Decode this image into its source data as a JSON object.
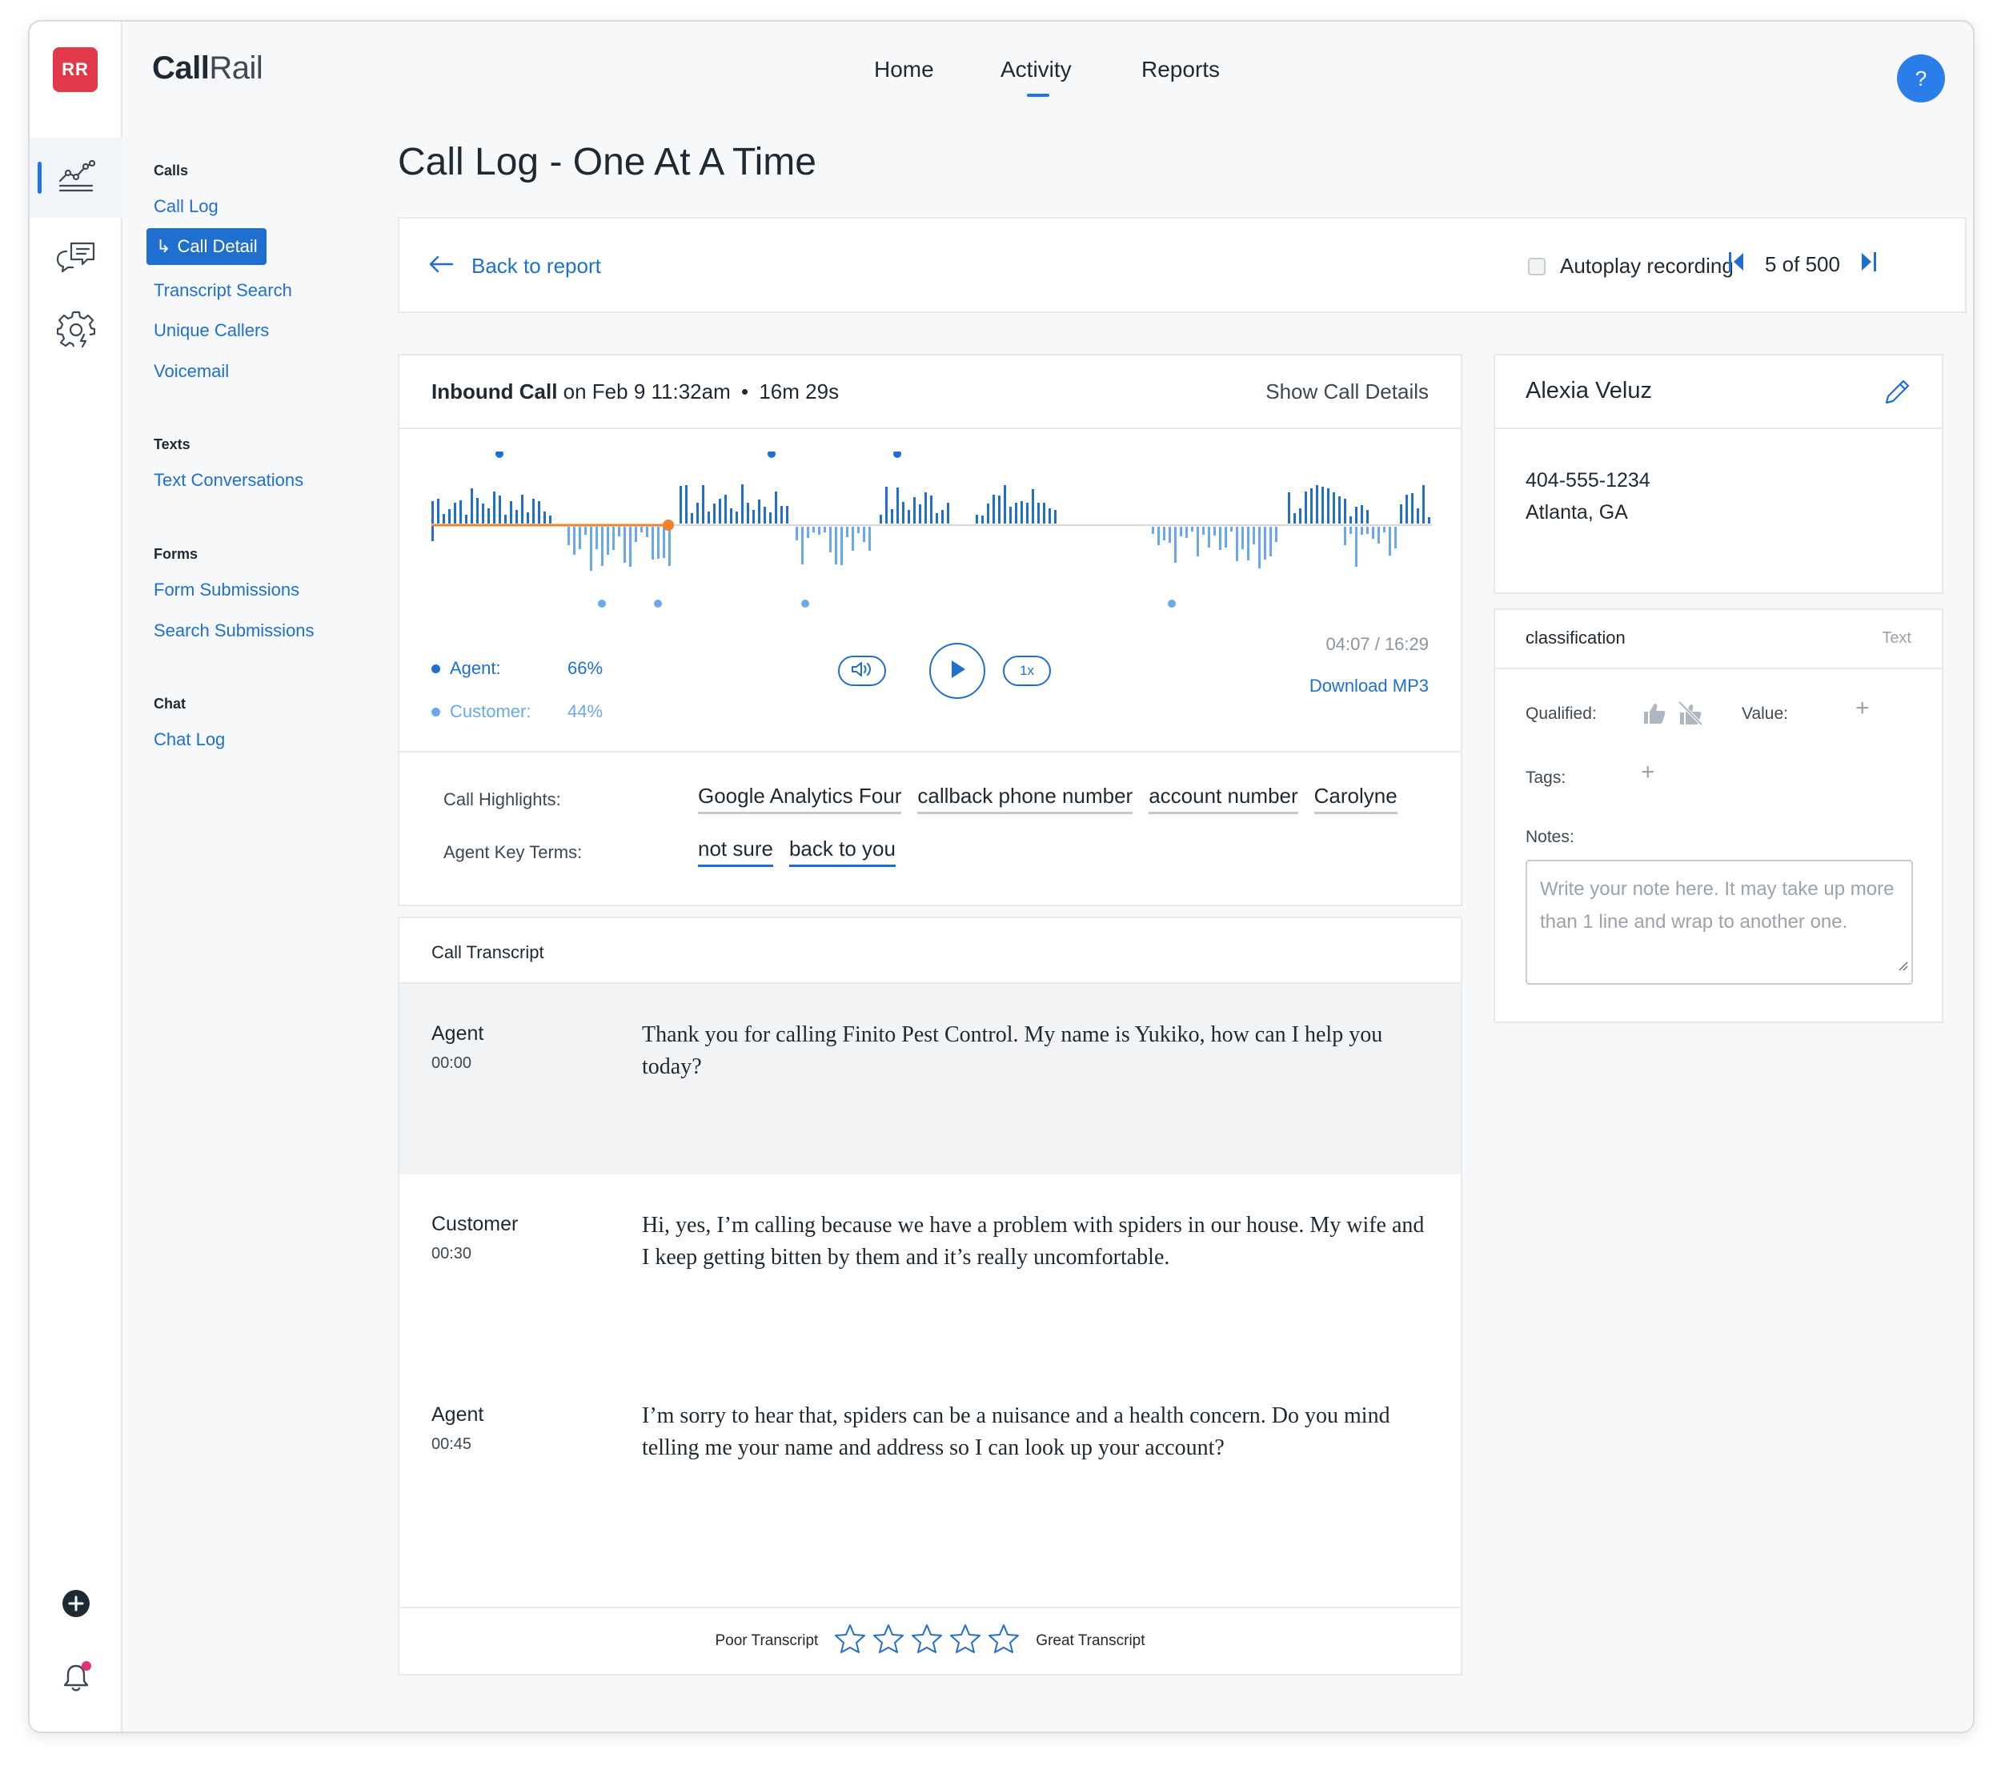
{
  "app": {
    "avatar_initials": "RR",
    "logo_bold": "Call",
    "logo_light": "Rail",
    "help_label": "?"
  },
  "rail": {
    "icons": [
      "activity-chart-icon",
      "chat-bubbles-icon",
      "settings-gear-icon",
      "add-circle-icon",
      "bell-icon"
    ]
  },
  "topnav": {
    "items": [
      {
        "label": "Home",
        "active": false
      },
      {
        "label": "Activity",
        "active": true
      },
      {
        "label": "Reports",
        "active": false
      }
    ]
  },
  "sidebar": {
    "sections": [
      {
        "heading": "Calls",
        "items": [
          "Call Log",
          "Call Detail",
          "Transcript Search",
          "Unique Callers",
          "Voicemail"
        ],
        "active": "Call Detail"
      },
      {
        "heading": "Texts",
        "items": [
          "Text Conversations"
        ]
      },
      {
        "heading": "Forms",
        "items": [
          "Form Submissions",
          "Search Submissions"
        ]
      },
      {
        "heading": "Chat",
        "items": [
          "Chat Log"
        ]
      }
    ]
  },
  "page": {
    "title": "Call Log - One At A Time"
  },
  "navbar": {
    "back_label": "Back to report",
    "autoplay_label": "Autoplay recording",
    "autoplay_checked": false,
    "pager": "5 of 500"
  },
  "call": {
    "direction": "Inbound Call",
    "date_text": "on Feb 9 11:32am",
    "separator": "•",
    "duration": "16m 29s",
    "show_details": "Show Call Details",
    "agent_label": "Agent:",
    "agent_pct": "66%",
    "customer_label": "Customer:",
    "customer_pct": "44%",
    "speed": "1x",
    "timecode": "04:07 / 16:29",
    "progress_fraction": 0.25,
    "download": "Download MP3",
    "highlights_label": "Call Highlights:",
    "highlights": [
      "Google Analytics Four",
      "callback phone number",
      "account number",
      "Carolyne"
    ],
    "agent_terms_label": "Agent Key Terms:",
    "agent_terms": [
      "not sure",
      "back to you"
    ],
    "colors": {
      "agent": "#1f6fd1",
      "customer": "#6aa8ee",
      "progress": "#f0822e"
    }
  },
  "transcript": {
    "title": "Call Transcript",
    "rows": [
      {
        "speaker": "Agent",
        "time": "00:00",
        "text": "Thank you for calling Finito Pest Control. My name is Yukiko, how can I help you today?"
      },
      {
        "speaker": "Customer",
        "time": "00:30",
        "text": "Hi, yes, I’m calling because we have a problem with spiders in our house. My wife and I keep getting bitten by them and it’s really uncomfortable."
      },
      {
        "speaker": "Agent",
        "time": "00:45",
        "text": "I’m sorry to hear that, spiders can be a nuisance and a health concern. Do you mind telling me your name and address so I can look up your account?"
      }
    ],
    "rating_low": "Poor Transcript",
    "rating_high": "Great Transcript",
    "stars": 5
  },
  "contact": {
    "name": "Alexia Veluz",
    "phone": "404-555-1234",
    "location": "Atlanta, GA"
  },
  "classification": {
    "title": "classification",
    "mode": "Text",
    "qualified_label": "Qualified:",
    "value_label": "Value:",
    "tags_label": "Tags:",
    "notes_label": "Notes:",
    "notes_placeholder": "Write your note here. It may take up more than 1 line and wrap to another one."
  }
}
